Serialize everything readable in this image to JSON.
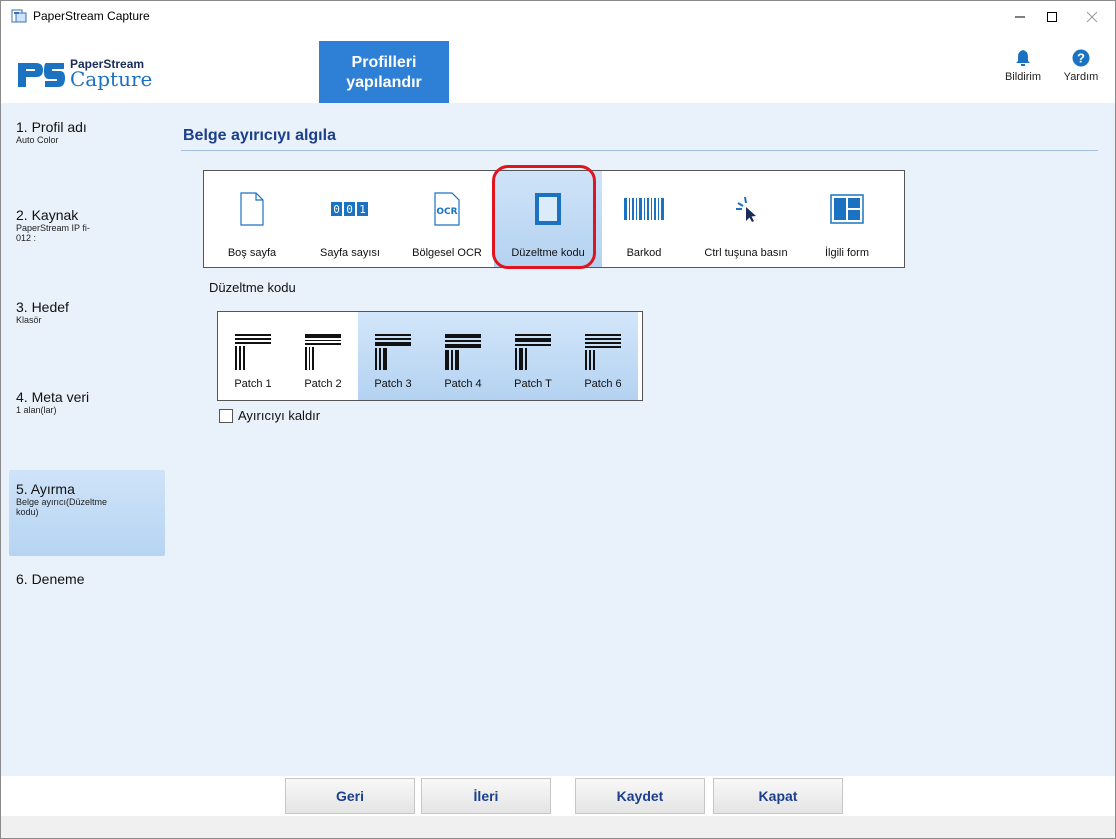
{
  "window": {
    "title": "PaperStream Capture"
  },
  "logo": {
    "top": "PaperStream",
    "bottom": "Capture"
  },
  "header": {
    "config_button_line1": "Profilleri",
    "config_button_line2": "yapılandır",
    "notification_label": "Bildirim",
    "help_label": "Yardım"
  },
  "sidebar": {
    "steps": [
      {
        "label": "1. Profil adı",
        "sub": "Auto Color"
      },
      {
        "label": "2. Kaynak",
        "sub": "PaperStream IP fi-",
        "sub2": "012 :"
      },
      {
        "label": "3. Hedef",
        "sub": "Klasör"
      },
      {
        "label": "4. Meta veri",
        "sub": "1 alan(lar)"
      },
      {
        "label": "5. Ayırma",
        "sub": "Belge ayırıcı(Düzeltme",
        "sub2": "kodu)"
      },
      {
        "label": "6. Deneme"
      }
    ]
  },
  "main": {
    "section_title": "Belge ayırıcıyı algıla",
    "separator_types": [
      {
        "label": "Boş sayfa",
        "icon": "blank-page-icon"
      },
      {
        "label": "Sayfa sayısı",
        "icon": "page-count-icon"
      },
      {
        "label": "Bölgesel OCR",
        "icon": "ocr-icon"
      },
      {
        "label": "Düzeltme kodu",
        "icon": "patch-code-icon",
        "selected": true
      },
      {
        "label": "Barkod",
        "icon": "barcode-icon"
      },
      {
        "label": "Ctrl tuşuna basın",
        "icon": "cursor-click-icon"
      },
      {
        "label": "İlgili form",
        "icon": "form-icon"
      }
    ],
    "patch_label": "Düzeltme kodu",
    "patch_codes": [
      {
        "label": "Patch 1",
        "selected": false
      },
      {
        "label": "Patch 2",
        "selected": false
      },
      {
        "label": "Patch 3",
        "selected": true
      },
      {
        "label": "Patch 4",
        "selected": true
      },
      {
        "label": "Patch T",
        "selected": true
      },
      {
        "label": "Patch 6",
        "selected": true
      }
    ],
    "remove_separator_label": "Ayırıcıyı kaldır",
    "remove_separator_checked": false
  },
  "buttons": {
    "back": "Geri",
    "next": "İleri",
    "save": "Kaydet",
    "close": "Kapat"
  },
  "colors": {
    "accent": "#2e7fd6",
    "title_blue": "#1c3f8c",
    "highlight_red": "#e0141e",
    "panel_bg": "#e9f1fb"
  }
}
